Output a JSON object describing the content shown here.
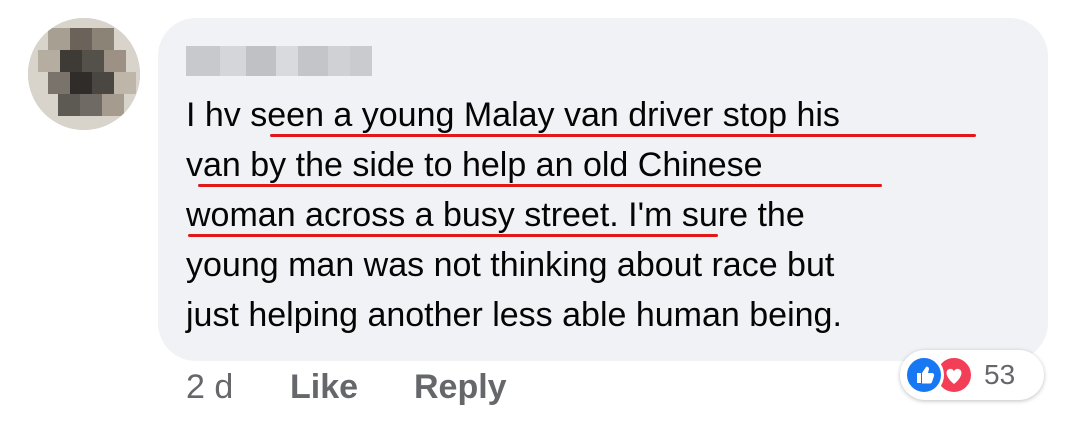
{
  "comment": {
    "author_name": "",
    "text": "I hv seen a young Malay van driver stop his van by the side to help an old Chinese woman across a busy street. I'm sure the young man was not thinking about race but just helping another less able human being.",
    "lines": [
      "I hv seen a young Malay van driver stop his",
      "van by the side to help an old Chinese",
      "woman across a busy street. I'm sure the",
      "young man was not thinking about race but",
      "just helping another less able human being."
    ],
    "highlight_color": "#e01818"
  },
  "actions": {
    "timestamp": "2 d",
    "like_label": "Like",
    "reply_label": "Reply"
  },
  "reactions": {
    "icons": [
      "like-icon",
      "love-icon"
    ],
    "count": "53",
    "like_color": "#1877f2",
    "love_color": "#f33e58"
  },
  "colors": {
    "bubble": "#f0f2f5",
    "text": "#050505",
    "secondary_text": "#65676b"
  }
}
